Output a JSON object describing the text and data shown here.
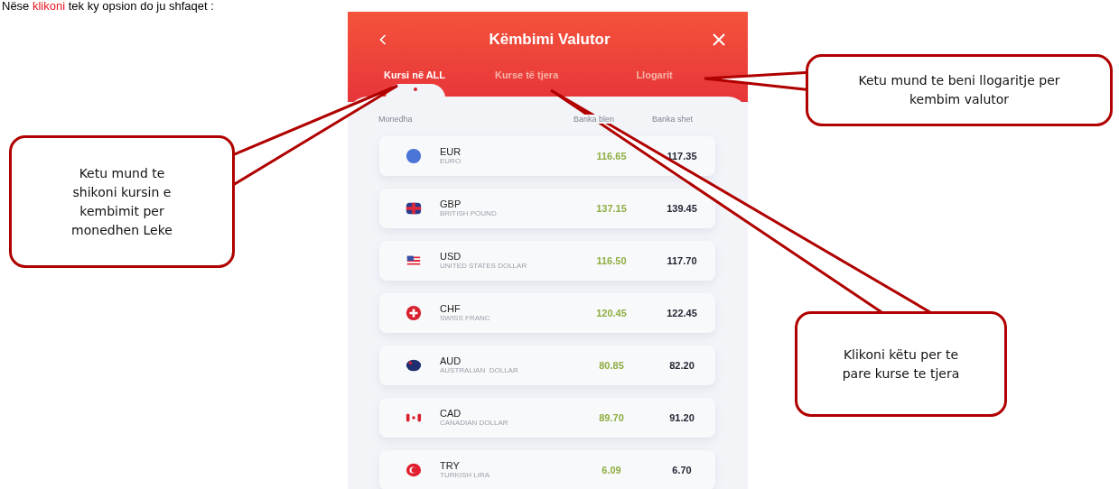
{
  "intro": {
    "before": "Nëse ",
    "highlight": "klikoni",
    "after": " tek ky opsion do ju shfaqet :"
  },
  "app": {
    "title": "Këmbimi Valutor",
    "tabs": [
      {
        "label": "Kursi në ALL",
        "selected": true
      },
      {
        "label": "Kurse të tjera",
        "selected": false
      },
      {
        "label": "Llogarit",
        "selected": false
      }
    ],
    "columns": [
      "Monedha",
      "Banka blen",
      "Banka shet"
    ],
    "rows": [
      {
        "kind": "euro",
        "code": "EUR",
        "name": "EURO",
        "buy": "116.65",
        "sell": "117.35"
      },
      {
        "kind": "uk",
        "code": "GBP",
        "name": "BRITISH POUND",
        "buy": "137.15",
        "sell": "139.45"
      },
      {
        "kind": "us",
        "code": "USD",
        "name": "UNITED STATES DOLLAR",
        "buy": "116.50",
        "sell": "117.70"
      },
      {
        "kind": "swiss",
        "code": "CHF",
        "name": "SWISS FRANC",
        "buy": "120.45",
        "sell": "122.45"
      },
      {
        "kind": "australia",
        "code": "AUD",
        "name": "AUSTRALIAN  DOLLAR",
        "buy": "80.85",
        "sell": "82.20"
      },
      {
        "kind": "canada",
        "code": "CAD",
        "name": "CANADIAN DOLLAR",
        "buy": "89.70",
        "sell": "91.20"
      },
      {
        "kind": "turkey",
        "code": "TRY",
        "name": "TURKISH LIRA",
        "buy": "6.09",
        "sell": "6.70"
      }
    ]
  },
  "callouts": [
    {
      "kind": "left",
      "text": "Ketu mund te shikoni kursin e kembimit per monedhen Leke"
    },
    {
      "kind": "top",
      "text": "Ketu mund te beni llogaritje per kembim valutor"
    },
    {
      "kind": "bottom",
      "text": "Klikoni këtu per te pare kurse te tjera"
    }
  ]
}
